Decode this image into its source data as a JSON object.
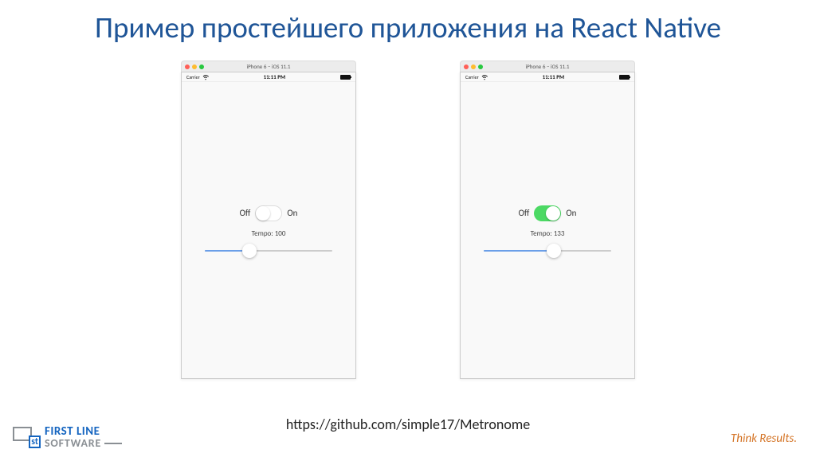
{
  "slide": {
    "title": "Пример простейшего приложения на React Native",
    "url": "https://github.com/simple17/Metronome",
    "footer_tag": "Think Results.",
    "logo": {
      "line1": "FIRST LINE",
      "line2": "SOFTWARE",
      "mark": "st"
    }
  },
  "simulators": [
    {
      "titlebar": "iPhone 6 – iOS 11.1",
      "carrier": "Carrier",
      "time": "11:11 PM",
      "switch": {
        "off_label": "Off",
        "on_label": "On",
        "state": "off"
      },
      "tempo_label": "Tempo: 100",
      "slider": {
        "percent": 35
      }
    },
    {
      "titlebar": "iPhone 6 – iOS 11.1",
      "carrier": "Carrier",
      "time": "11:11 PM",
      "switch": {
        "off_label": "Off",
        "on_label": "On",
        "state": "on"
      },
      "tempo_label": "Tempo: 133",
      "slider": {
        "percent": 55
      }
    }
  ]
}
